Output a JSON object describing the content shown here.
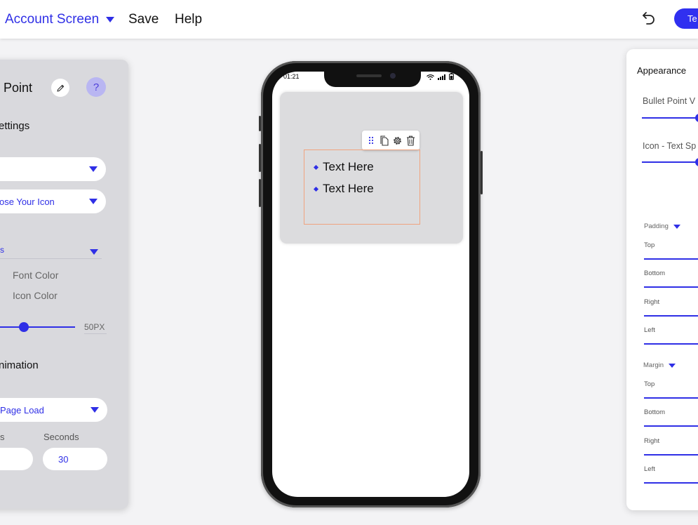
{
  "topbar": {
    "screen_name": "Account Screen",
    "save_label": "Save",
    "help_label": "Help",
    "test_label": "Te"
  },
  "left_panel": {
    "title": "Point",
    "help_symbol": "?",
    "settings_heading": "ettings",
    "dropdown1_value": "",
    "icon_select_value": "ose Your Icon",
    "style_select_value": "s",
    "font_color_label": "Font Color",
    "icon_color_label": "Icon Color",
    "size_value": "50PX",
    "size_level": 0.33,
    "animation_heading": "nimation",
    "trigger_value": "Page Load",
    "label_left": "s",
    "seconds_label": "Seconds",
    "field_left_value": "",
    "seconds_value": "30"
  },
  "phone": {
    "time": "01:21",
    "bullets": [
      "Text Here",
      "Text Here"
    ]
  },
  "right_panel": {
    "title": "Appearance",
    "bullet_label": "Bullet Point V",
    "icon_text_label": "Icon - Text Sp",
    "padding_label": "Padding",
    "margin_label": "Margin",
    "padding_fields": [
      "Top",
      "Bottom",
      "Right",
      "Left"
    ],
    "margin_fields": [
      "Top",
      "Bottom",
      "Right",
      "Left"
    ]
  },
  "colors": {
    "accent": "#2f2fe6",
    "panel_bg": "#d9d9dd",
    "selection": "#f0a37e"
  },
  "icons": [
    "chevron-down-icon",
    "undo-icon",
    "pencil-icon",
    "drag-handle-icon",
    "copy-icon",
    "gear-icon",
    "trash-icon",
    "wifi-icon",
    "signal-icon",
    "battery-icon"
  ]
}
